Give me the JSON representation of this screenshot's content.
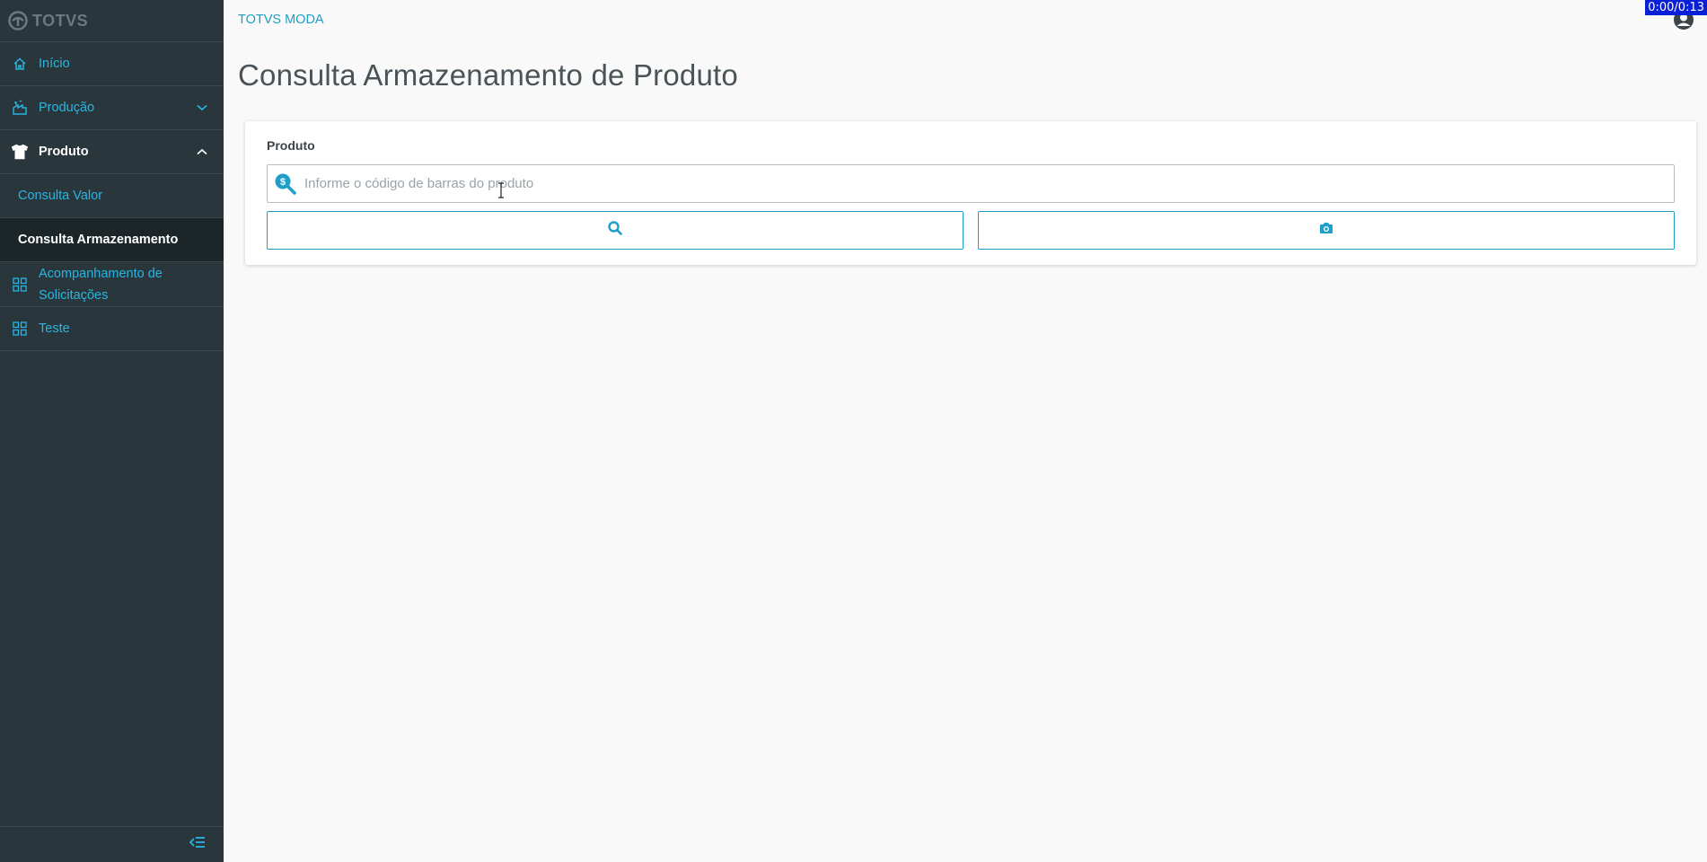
{
  "sidebar": {
    "logo_text": "TOTVS",
    "items": [
      {
        "label": "Início",
        "icon": "home-icon"
      },
      {
        "label": "Produção",
        "icon": "factory-icon"
      },
      {
        "label": "Produto",
        "icon": "shirt-icon"
      }
    ],
    "sub_items": [
      {
        "label": "Consulta Valor"
      },
      {
        "label": "Consulta Armazenamento"
      }
    ],
    "items_after": [
      {
        "label_line1": "Acompanhamento de",
        "label_line2": "Solicitações",
        "icon": "grid-icon"
      },
      {
        "label": "Teste",
        "icon": "grid-icon"
      }
    ]
  },
  "header": {
    "brand": "TOTVS MODA",
    "timer": "0:00/0:13"
  },
  "main": {
    "title": "Consulta Armazenamento de Produto",
    "field_label": "Produto",
    "input_placeholder": "Informe o código de barras do produto",
    "input_value": ""
  },
  "colors": {
    "sidebar_bg": "#29363b",
    "accent": "#1d9fc7",
    "active_bg": "#1c2528"
  }
}
